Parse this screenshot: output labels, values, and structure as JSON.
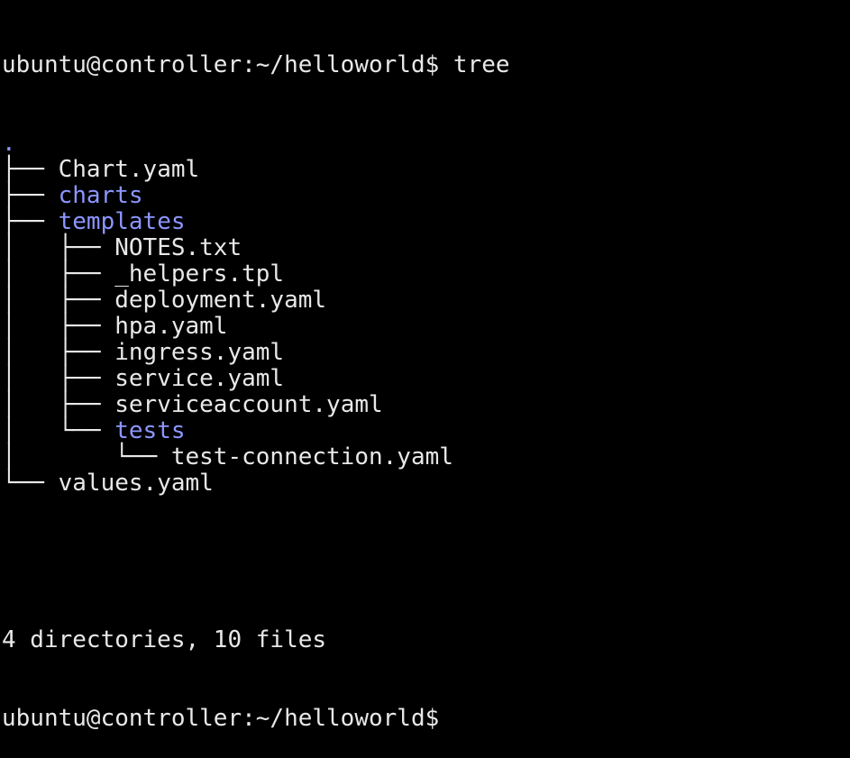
{
  "terminal": {
    "prompt": "ubuntu@controller:~/helloworld$",
    "command": "tree",
    "colors": {
      "background": "#000000",
      "text": "#e8e8e8",
      "directory": "#8c96ff"
    },
    "tree": [
      {
        "prefix": "",
        "name": ".",
        "type": "dir"
      },
      {
        "prefix": "├── ",
        "name": "Chart.yaml",
        "type": "file"
      },
      {
        "prefix": "├── ",
        "name": "charts",
        "type": "dir"
      },
      {
        "prefix": "├── ",
        "name": "templates",
        "type": "dir"
      },
      {
        "prefix": "│   ├── ",
        "name": "NOTES.txt",
        "type": "file"
      },
      {
        "prefix": "│   ├── ",
        "name": "_helpers.tpl",
        "type": "file"
      },
      {
        "prefix": "│   ├── ",
        "name": "deployment.yaml",
        "type": "file"
      },
      {
        "prefix": "│   ├── ",
        "name": "hpa.yaml",
        "type": "file"
      },
      {
        "prefix": "│   ├── ",
        "name": "ingress.yaml",
        "type": "file"
      },
      {
        "prefix": "│   ├── ",
        "name": "service.yaml",
        "type": "file"
      },
      {
        "prefix": "│   ├── ",
        "name": "serviceaccount.yaml",
        "type": "file"
      },
      {
        "prefix": "│   └── ",
        "name": "tests",
        "type": "dir"
      },
      {
        "prefix": "│       └── ",
        "name": "test-connection.yaml",
        "type": "file"
      },
      {
        "prefix": "└── ",
        "name": "values.yaml",
        "type": "file"
      }
    ],
    "summary": "4 directories, 10 files",
    "final_prompt": "ubuntu@controller:~/helloworld$"
  }
}
